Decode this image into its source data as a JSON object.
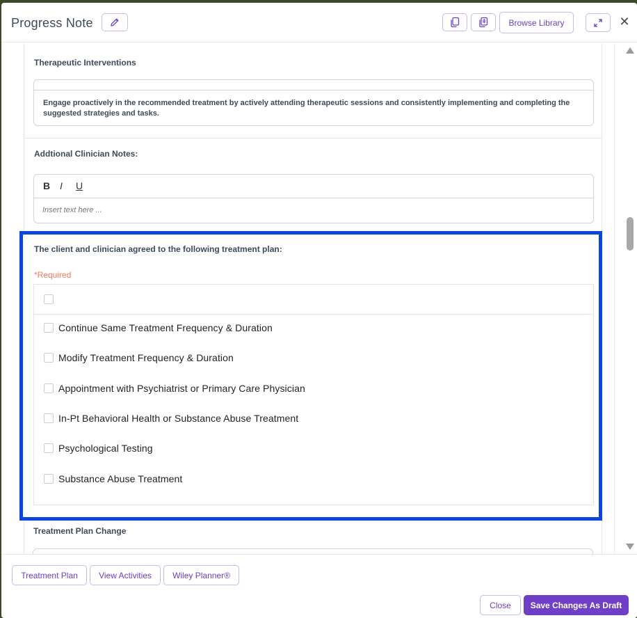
{
  "header": {
    "title": "Progress Note",
    "browse_library": "Browse Library"
  },
  "therapeutic_interventions": {
    "label": "Therapeutic Interventions",
    "text": "Engage proactively in the recommended treatment by actively attending therapeutic sessions and consistently implementing and completing the suggested strategies and tasks."
  },
  "additional_notes": {
    "label": "Addtional Clinician Notes:",
    "toolbar": {
      "bold": "B",
      "italic": "I",
      "underline": "U"
    },
    "placeholder": "Insert text here ..."
  },
  "treatment_plan": {
    "label": "The client and clinician agreed to the following treatment plan:",
    "required": "*Required",
    "options": [
      {
        "label": "Continue Same Treatment Frequency & Duration",
        "checked": false
      },
      {
        "label": "Modify Treatment Frequency & Duration",
        "checked": false
      },
      {
        "label": "Appointment with Psychiatrist or Primary Care Physician",
        "checked": false
      },
      {
        "label": "In-Pt Behavioral Health or Substance Abuse Treatment",
        "checked": false
      },
      {
        "label": "Psychological Testing",
        "checked": false
      },
      {
        "label": "Substance Abuse Treatment",
        "checked": false
      }
    ]
  },
  "treatment_plan_change": {
    "label": "Treatment Plan Change"
  },
  "footer": {
    "treatment_plan": "Treatment Plan",
    "view_activities": "View Activities",
    "wiley_planner": "Wiley Planner®",
    "close": "Close",
    "save": "Save Changes As Draft"
  },
  "colors": {
    "accent": "#6f3fc8",
    "highlight": "#0b45d9",
    "required": "#f07a5a"
  },
  "icons": [
    "pencil-icon",
    "copy-icon",
    "paste-icon",
    "expand-icon",
    "close-icon",
    "scroll-up-icon",
    "scroll-down-icon"
  ]
}
